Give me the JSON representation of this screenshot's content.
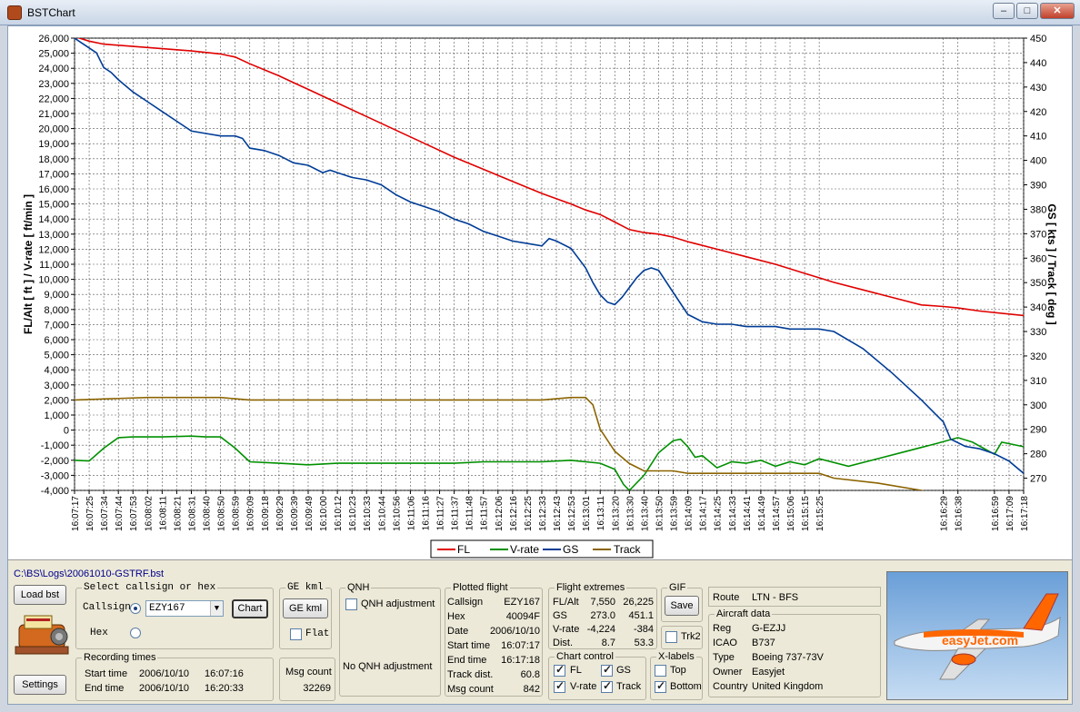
{
  "window": {
    "title": "BSTChart",
    "min": "–",
    "max": "□",
    "close": "✕"
  },
  "colors": {
    "fl": "#e00000",
    "vrate": "#009000",
    "gs": "#003c96",
    "track": "#8c6400"
  },
  "chart_data": {
    "type": "line",
    "ylabel_left": "FL/Alt [ ft ] / V-rate [ ft/min ]",
    "ylabel_right": "GS [ kts ] / Track [ deg ]",
    "ylim_left": [
      -4000,
      26000
    ],
    "ylim_right": [
      265,
      450
    ],
    "yticks_left": [
      "26,000",
      "25,000",
      "24,000",
      "23,000",
      "22,000",
      "21,000",
      "20,000",
      "19,000",
      "18,000",
      "17,000",
      "16,000",
      "15,000",
      "14,000",
      "13,000",
      "12,000",
      "11,000",
      "10,000",
      "9,000",
      "8,000",
      "7,000",
      "6,000",
      "5,000",
      "4,000",
      "3,000",
      "2,000",
      "1,000",
      "0",
      "-1,000",
      "-2,000",
      "-3,000",
      "-4,000"
    ],
    "yticks_right": [
      "450",
      "440",
      "430",
      "420",
      "410",
      "400",
      "390",
      "380",
      "370",
      "360",
      "350",
      "340",
      "330",
      "320",
      "310",
      "300",
      "290",
      "280",
      "270"
    ],
    "xticks": [
      "16:07:17",
      "16:07:25",
      "16:07:34",
      "16:07:44",
      "16:07:53",
      "16:08:02",
      "16:08:11",
      "16:08:21",
      "16:08:31",
      "16:08:40",
      "16:08:50",
      "16:08:59",
      "16:09:09",
      "16:09:18",
      "16:09:29",
      "16:09:39",
      "16:09:49",
      "16:10:00",
      "16:10:12",
      "16:10:23",
      "16:10:33",
      "16:10:44",
      "16:10:56",
      "16:11:06",
      "16:11:16",
      "16:11:27",
      "16:11:37",
      "16:11:48",
      "16:11:57",
      "16:12:06",
      "16:12:16",
      "16:12:25",
      "16:12:33",
      "16:12:43",
      "16:12:53",
      "16:13:01",
      "16:13:11",
      "16:13:20",
      "16:13:30",
      "16:13:40",
      "16:13:50",
      "16:13:59",
      "16:14:09",
      "16:14:17",
      "16:14:25",
      "16:14:33",
      "16:14:41",
      "16:14:49",
      "16:14:57",
      "16:15:06",
      "16:15:15",
      "16:15:25",
      "16:16:29",
      "16:16:38",
      "16:16:59",
      "16:17:09",
      "16:17:18"
    ],
    "xtick_index": [
      0,
      1,
      2,
      3,
      4,
      5,
      6,
      7,
      8,
      9,
      10,
      11,
      12,
      13,
      14,
      15,
      16,
      17,
      18,
      19,
      20,
      21,
      22,
      23,
      24,
      25,
      26,
      27,
      28,
      29,
      30,
      31,
      32,
      33,
      34,
      35,
      36,
      37,
      38,
      39,
      40,
      41,
      42,
      43,
      44,
      45,
      46,
      47,
      48,
      49,
      50,
      51,
      59.5,
      60.5,
      63,
      64,
      65
    ],
    "series": [
      {
        "name": "FL",
        "axis": "left",
        "x": [
          0,
          1,
          2,
          4,
          6,
          8,
          10,
          11,
          12,
          13,
          14,
          15,
          16,
          18,
          20,
          22,
          24,
          26,
          28,
          30,
          32,
          34,
          35,
          36,
          37,
          38,
          39,
          40,
          41,
          42,
          44,
          46,
          48,
          50,
          51,
          52,
          54,
          56,
          58,
          59.5,
          60.5,
          62,
          64,
          65
        ],
        "y": [
          26100,
          25800,
          25600,
          25450,
          25300,
          25150,
          24950,
          24750,
          24300,
          23900,
          23500,
          23050,
          22600,
          21700,
          20800,
          19900,
          19000,
          18100,
          17300,
          16500,
          15700,
          15000,
          14600,
          14300,
          13800,
          13300,
          13100,
          13000,
          12800,
          12500,
          12000,
          11500,
          11000,
          10400,
          10100,
          9800,
          9300,
          8800,
          8300,
          8200,
          8100,
          7900,
          7700,
          7600
        ]
      },
      {
        "name": "V-rate",
        "axis": "left",
        "x": [
          0,
          1,
          2,
          3,
          4,
          6,
          8,
          9,
          10,
          11,
          12,
          14,
          16,
          18,
          20,
          22,
          24,
          26,
          28,
          30,
          32,
          34,
          35,
          36,
          37,
          37.6,
          38,
          39,
          40,
          41,
          41.5,
          42,
          42.5,
          43,
          44,
          45,
          46,
          47,
          48,
          49,
          50,
          51,
          53,
          55,
          57,
          59,
          60.5,
          61.5,
          63,
          63.5,
          64,
          65
        ],
        "y": [
          -2000,
          -2050,
          -1200,
          -500,
          -450,
          -450,
          -400,
          -450,
          -450,
          -1200,
          -2100,
          -2200,
          -2300,
          -2200,
          -2200,
          -2200,
          -2200,
          -2200,
          -2100,
          -2100,
          -2100,
          -2000,
          -2100,
          -2200,
          -2600,
          -3600,
          -4000,
          -3000,
          -1500,
          -700,
          -600,
          -1100,
          -1800,
          -1700,
          -2500,
          -2100,
          -2200,
          -2000,
          -2400,
          -2100,
          -2300,
          -1900,
          -2400,
          -1900,
          -1400,
          -900,
          -500,
          -800,
          -1600,
          -800,
          -900,
          -1100
        ]
      },
      {
        "name": "GS",
        "axis": "right",
        "x": [
          0,
          0.5,
          1,
          1.5,
          2,
          2.5,
          3,
          4,
          5,
          6,
          7,
          8,
          9,
          10,
          11,
          11.5,
          12,
          13,
          14,
          15,
          16,
          17,
          17.5,
          18,
          19,
          20,
          21,
          22,
          23,
          24,
          25,
          26,
          27,
          28,
          29,
          30,
          31,
          32,
          32.5,
          33,
          34,
          35,
          35.5,
          36,
          36.5,
          37,
          37.5,
          38,
          38.5,
          39,
          39.5,
          40,
          41,
          42,
          43,
          44,
          45,
          46,
          47,
          48,
          49,
          50,
          51,
          52,
          54,
          56,
          58,
          59,
          59.5,
          60,
          61,
          62,
          63,
          64,
          65
        ],
        "y": [
          450,
          448,
          446,
          444,
          438,
          436,
          433,
          428,
          424,
          420,
          416,
          412,
          411,
          410,
          410,
          409,
          405,
          404,
          402,
          399,
          398,
          395,
          396,
          395,
          393,
          392,
          390,
          386,
          383,
          381,
          379,
          376,
          374,
          371,
          369,
          367,
          366,
          365,
          368,
          367,
          364,
          356,
          350,
          345,
          342,
          341,
          344,
          348,
          352,
          355,
          356,
          355,
          346,
          337,
          334,
          333,
          333,
          332,
          332,
          332,
          331,
          331,
          331,
          330,
          323,
          313,
          302,
          296,
          293,
          286,
          283,
          282,
          280,
          277,
          272
        ]
      },
      {
        "name": "Track",
        "axis": "right",
        "x": [
          0,
          5,
          10,
          12,
          14,
          16,
          18,
          20,
          22,
          24,
          26,
          28,
          30,
          32,
          34,
          35,
          35.5,
          36,
          37,
          38,
          39,
          40,
          41,
          42,
          44,
          46,
          48,
          50,
          51,
          52,
          55,
          58,
          59.5,
          60.5,
          63,
          65
        ],
        "y": [
          302,
          303,
          303,
          302,
          302,
          302,
          302,
          302,
          302,
          302,
          302,
          302,
          302,
          302,
          303,
          303,
          300,
          290,
          281,
          276,
          273,
          273,
          273,
          272,
          272,
          272,
          272,
          272,
          272,
          270,
          268,
          265,
          263,
          263,
          263,
          263
        ]
      }
    ],
    "legend": [
      "FL",
      "V-rate",
      "GS",
      "Track"
    ],
    "legend_position": "bottom-center",
    "grid": true
  },
  "file": {
    "path": "C:\\BS\\Logs\\20061010-GSTRF.bst"
  },
  "buttons": {
    "load": "Load bst",
    "settings": "Settings",
    "chart": "Chart",
    "ge_kml": "GE kml",
    "save": "Save"
  },
  "select": {
    "title": "Select callsign or hex",
    "callsign_label": "Callsign",
    "callsign_value": "EZY167",
    "hex_label": "Hex"
  },
  "ge": {
    "title": "GE kml",
    "flat_label": "Flat"
  },
  "qnh": {
    "title": "QNH",
    "adjust_label": "QNH adjustment",
    "status": "No QNH adjustment"
  },
  "recording": {
    "title": "Recording times",
    "start_label": "Start time",
    "start_date": "2006/10/10",
    "start_time": "16:07:16",
    "end_label": "End time",
    "end_date": "2006/10/10",
    "end_time": "16:20:33",
    "msg_label": "Msg count",
    "msg_value": "32269"
  },
  "plotted": {
    "title": "Plotted flight",
    "rows": [
      {
        "k": "Callsign",
        "v": "EZY167"
      },
      {
        "k": "Hex",
        "v": "40094F"
      },
      {
        "k": "Date",
        "v": "2006/10/10"
      },
      {
        "k": "Start time",
        "v": "16:07:17"
      },
      {
        "k": "End time",
        "v": "16:17:18"
      },
      {
        "k": "Track dist.",
        "v": "60.8"
      },
      {
        "k": "Msg count",
        "v": "842"
      }
    ]
  },
  "extremes": {
    "title": "Flight extremes",
    "rows": [
      {
        "k": "FL/Alt",
        "min": "7,550",
        "max": "26,225"
      },
      {
        "k": "GS",
        "min": "273.0",
        "max": "451.1"
      },
      {
        "k": "V-rate",
        "min": "-4,224",
        "max": "-384"
      },
      {
        "k": "Dist.",
        "min": "8.7",
        "max": "53.3"
      }
    ]
  },
  "gif": {
    "title": "GIF",
    "trk2": "Trk2"
  },
  "chart_control": {
    "title": "Chart control",
    "fl": "FL",
    "gs": "GS",
    "vrate": "V-rate",
    "track": "Track"
  },
  "xlabels": {
    "title": "X-labels",
    "top": "Top",
    "bottom": "Bottom"
  },
  "route": {
    "label": "Route",
    "value": "LTN - BFS"
  },
  "aircraft": {
    "title": "Aircraft data",
    "rows": [
      {
        "k": "Reg",
        "v": "G-EZJJ"
      },
      {
        "k": "ICAO",
        "v": "B737"
      },
      {
        "k": "Type",
        "v": "Boeing 737-73V"
      },
      {
        "k": "Owner",
        "v": "Easyjet"
      },
      {
        "k": "Country",
        "v": "United Kingdom"
      }
    ]
  },
  "photo": {
    "livery_text": "easyJet.com"
  }
}
